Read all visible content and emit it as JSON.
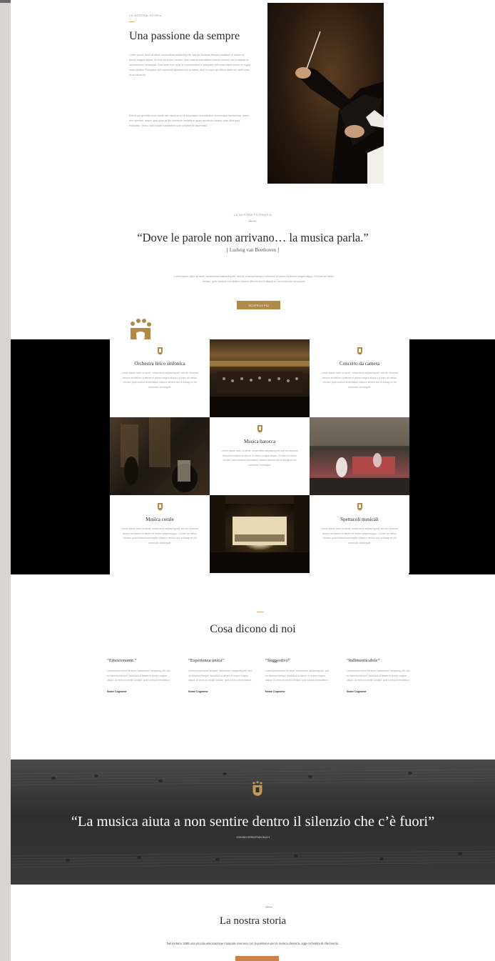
{
  "intro": {
    "kicker": "LA NOSTRA STORIA",
    "title": "Una passione da sempre",
    "paragraph1": "Lorem ipsum dolor sit amet, consectetur adipiscing elit, sed do eiusmod tempor incididunt ut labore et dolore magna aliqua. Ut enim ad minim veniam, quis nostrud exercitation ullamco laboris nisi ut aliquip ex ea commodo consequat. Duis aute irure dolor in reprehenderit in voluptate velit esse cillum dolore eu fugiat nulla pariatur. Excepteur sint occaecat cupidatat non proident, sunt in culpa qui officia deserunt mollit anim id est laborum.",
    "paragraph2": "Sed ut perspiciatis unde omnis iste natus error sit voluptatem accusantium doloremque laudantium, totam rem aperiam, eaque ipsa quae ab illo inventore veritatis et quasi architecto beatae vitae dicta sunt explicabo. Nemo enim ipsam voluptatem quia voluptas sit aspernatur."
  },
  "quote": {
    "kicker": "LA NOSTRA FILOSOFIA",
    "text": "“Dove le parole non arrivano… la musica parla.”",
    "author": "[  Ludwig van Beethoven  ]",
    "paragraph": "Lorem ipsum dolor sit amet, consectetur adipiscing elit, sed do eiusmod tempor incididunt ut labore et dolore magna aliqua. Ut enim ad minim veniam, quis nostrud exercitation ullamco laboris nisi ut aliquip ex ea commodo consequat.",
    "button": "SCOPRI DI PIÙ"
  },
  "services": [
    {
      "title": "Orchestra lirico sinfonica",
      "desc": "Lorem ipsum dolor sit amet, consectetur adipiscing elit, sed do eiusmod tempor incididunt ut labore et dolore magna aliqua. Ut enim ad minim veniam, quis nostrud exercitation ullamco laboris nisi ut aliquip ex ea commodo consequat."
    },
    {
      "title": "Concerto da camera",
      "desc": "Lorem ipsum dolor sit amet, consectetur adipiscing elit, sed do eiusmod tempor incididunt ut labore et dolore magna aliqua. Ut enim ad minim veniam, quis nostrud exercitation ullamco laboris nisi ut aliquip ex ea commodo consequat."
    },
    {
      "title": "Musica barocca",
      "desc": "Lorem ipsum dolor sit amet, consectetur adipiscing elit, sed do eiusmod tempor incididunt ut labore et dolore magna aliqua. Ut enim ad minim veniam, quis nostrud exercitation ullamco laboris nisi ut aliquip ex ea commodo consequat."
    },
    {
      "title": "Musica corale",
      "desc": "Lorem ipsum dolor sit amet, consectetur adipiscing elit, sed do eiusmod tempor incididunt ut labore et dolore magna aliqua. Ut enim ad minim veniam, quis nostrud exercitation ullamco laboris nisi ut aliquip ex ea commodo consequat."
    },
    {
      "title": "Spettacoli musicali",
      "desc": "Lorem ipsum dolor sit amet, consectetur adipiscing elit, sed do eiusmod tempor incididunt ut labore et dolore magna aliqua. Ut enim ad minim veniam, quis nostrud exercitation ullamco laboris nisi ut aliquip ex ea commodo consequat."
    }
  ],
  "testimonials": {
    "title": "Cosa dicono di noi",
    "items": [
      {
        "quote": "“Emozionante.”",
        "body": "Lorem ipsum dolor sit amet, consectetur adipiscing elit, sed do eiusmod tempor incididunt ut labore et dolore magna aliqua. Ut enim ad minim veniam, quis nostrud exercitation.",
        "name": "Nome Cognome"
      },
      {
        "quote": "“Esperienza unica”",
        "body": "Lorem ipsum dolor sit amet, consectetur adipiscing elit, sed do eiusmod tempor incididunt ut labore et dolore magna aliqua. Ut enim ad minim veniam, quis nostrud exercitation.",
        "name": "Nome Cognome"
      },
      {
        "quote": "“Suggestivo”",
        "body": "Lorem ipsum dolor sit amet, consectetur adipiscing elit, sed do eiusmod tempor incididunt ut labore et dolore magna aliqua. Ut enim ad minim veniam, quis nostrud exercitation.",
        "name": "Nome Cognome"
      },
      {
        "quote": "“Indimenticabile”",
        "body": "Lorem ipsum dolor sit amet, consectetur adipiscing elit, sed do eiusmod tempor incididunt ut labore et dolore magna aliqua. Ut enim ad minim veniam, quis nostrud exercitation.",
        "name": "Nome Cognome"
      }
    ]
  },
  "banner": {
    "quote": "“La musica aiuta a non sentire dentro il silenzio che c’è fuori”",
    "author": "JOHANN SEBASTIAN BACH"
  },
  "story": {
    "title": "La nostra storia",
    "text": "Nel lontano 1985 una piccola associazione musicale nasceva con la passione per la musica classica, oggi orchestra di riferimento."
  },
  "colors": {
    "accent": "#b08a46",
    "dark": "#2e2e2e"
  }
}
